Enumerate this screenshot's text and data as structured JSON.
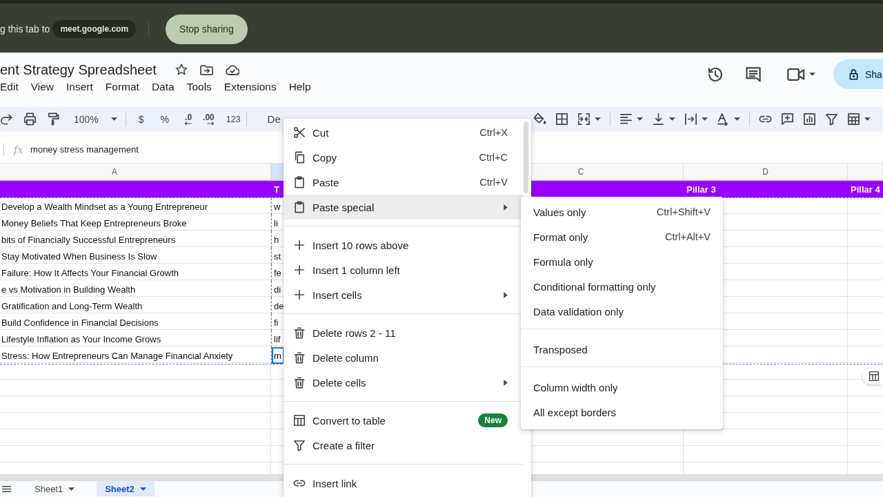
{
  "share_bar": {
    "message": "g this tab to",
    "site": "meet.google.com",
    "stop_button": "Stop sharing"
  },
  "document": {
    "title": "ent Strategy Spreadsheet"
  },
  "menu_bar": [
    "Edit",
    "View",
    "Insert",
    "Format",
    "Data",
    "Tools",
    "Extensions",
    "Help"
  ],
  "share_button": {
    "label": "Sha"
  },
  "toolbar": {
    "zoom": "100%",
    "currency": "$",
    "percent": "%",
    "decrease_decimal": ".0",
    "increase_decimal": ".00",
    "number_format": "123",
    "font": "De"
  },
  "formula_bar": {
    "fx": "fx",
    "value": "money stress management"
  },
  "sheet": {
    "copy_outline": true,
    "columns": [
      {
        "label": "A",
        "selected": false
      },
      {
        "selected": true,
        "header": "T"
      },
      {
        "label": "C",
        "selected": false
      },
      {
        "label": "D",
        "selected": false,
        "header": "Pillar 3"
      },
      {
        "selected": false,
        "header": "Pillar 4"
      }
    ],
    "rows": [
      {
        "cells": [
          "Develop a Wealth Mindset as a Young Entrepreneur",
          "w"
        ],
        "selected": false
      },
      {
        "cells": [
          "Money Beliefs That Keep Entrepreneurs Broke",
          "li"
        ],
        "selected": false
      },
      {
        "cells": [
          "bits of Financially Successful Entrepreneurs",
          "h"
        ],
        "selected": false
      },
      {
        "cells": [
          "Stay Motivated When Business Is Slow",
          "st"
        ],
        "selected": false
      },
      {
        "cells": [
          "Failure: How It Affects Your Financial Growth",
          "fe"
        ],
        "selected": false
      },
      {
        "cells": [
          "e vs Motivation in Building Wealth",
          "di"
        ],
        "selected": false
      },
      {
        "cells": [
          "Gratification and Long-Term Wealth",
          "de"
        ],
        "selected": false
      },
      {
        "cells": [
          "Build Confidence in Financial Decisions",
          "fi"
        ],
        "selected": false
      },
      {
        "cells": [
          "Lifestyle Inflation as Your Income Grows",
          "lif"
        ],
        "selected": false
      },
      {
        "cells": [
          "Stress: How Entrepreneurs Can Manage Financial Anxiety",
          "m"
        ],
        "selected": true
      }
    ]
  },
  "context_menu": {
    "sections": [
      [
        {
          "label": "Cut",
          "shortcut": "Ctrl+X",
          "submenu": false,
          "selected": false
        },
        {
          "label": "Copy",
          "shortcut": "Ctrl+C",
          "submenu": false,
          "selected": false
        },
        {
          "label": "Paste",
          "shortcut": "Ctrl+V",
          "submenu": false,
          "selected": false
        },
        {
          "label": "Paste special",
          "submenu": true,
          "selected": true
        }
      ],
      [
        {
          "label": "Insert 10 rows above",
          "submenu": false,
          "selected": false
        },
        {
          "label": "Insert 1 column left",
          "submenu": false,
          "selected": false
        },
        {
          "label": "Insert cells",
          "submenu": true,
          "selected": false
        }
      ],
      [
        {
          "label": "Delete rows 2 - 11",
          "submenu": false,
          "selected": false
        },
        {
          "label": "Delete column",
          "submenu": false,
          "selected": false
        },
        {
          "label": "Delete cells",
          "submenu": true,
          "selected": false
        }
      ],
      [
        {
          "label": "Convert to table",
          "badge": "New",
          "submenu": false,
          "selected": false
        },
        {
          "label": "Create a filter",
          "submenu": false,
          "selected": false
        }
      ],
      [
        {
          "label": "Insert link",
          "submenu": false,
          "selected": false
        }
      ]
    ]
  },
  "paste_special_menu": {
    "sections": [
      [
        {
          "label": "Values only",
          "shortcut": "Ctrl+Shift+V",
          "selected": false
        },
        {
          "label": "Format only",
          "shortcut": "Ctrl+Alt+V",
          "selected": false
        },
        {
          "label": "Formula only",
          "selected": false
        },
        {
          "label": "Conditional formatting only",
          "selected": false
        },
        {
          "label": "Data validation only",
          "selected": false
        }
      ],
      [
        {
          "label": "Transposed",
          "selected": false
        }
      ],
      [
        {
          "label": "Column width only",
          "selected": false
        },
        {
          "label": "All except borders",
          "selected": false
        }
      ]
    ]
  },
  "sheet_tabs": [
    {
      "label": "Sheet1",
      "selected": false
    },
    {
      "label": "Sheet2",
      "selected": true
    }
  ]
}
